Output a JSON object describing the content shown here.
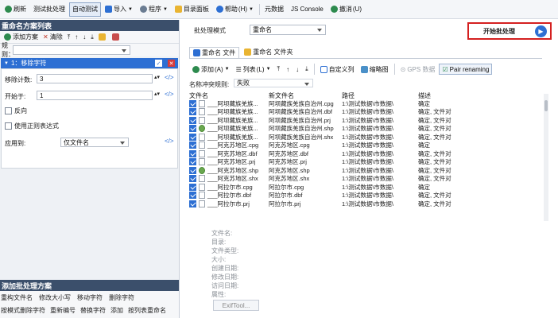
{
  "toolbar": {
    "refresh": "刷新",
    "test_batch": "测试批处理",
    "auto_test": "自动测试",
    "import": "导入",
    "program": "程序",
    "dir_panel": "目录面板",
    "help": "帮助",
    "help_key": "(H)",
    "metadata": "元数据",
    "js_console": "JS Console",
    "undo": "撤消",
    "undo_key": "(U)"
  },
  "left": {
    "rename_list_title": "重命名方案列表",
    "add_scheme": "添加方案",
    "clear": "清除",
    "rule_label": "规则：",
    "rule_item": "1：移除字符",
    "remove_count_label": "移除计数:",
    "remove_count_value": "3",
    "start_label": "开始于:",
    "start_value": "1",
    "reverse_label": "反向",
    "regex_label": "使用正则表达式",
    "apply_label": "应用到:",
    "apply_value": "仅文件名",
    "add_batch_title": "添加批处理方案",
    "actions_row1": [
      "重构文件名",
      "修改大小写",
      "移动字符",
      "删除字符"
    ],
    "actions_row2": [
      "按模式删除字符",
      "重新编号",
      "替换字符",
      "添加",
      "按列表重命名"
    ]
  },
  "right": {
    "mode_label": "批处理模式",
    "mode_value": "重命名",
    "start_button": "开始批处理",
    "tab_rename_files": "重命名 文件",
    "tab_rename_folders": "重命名 文件夹",
    "add": "添加",
    "add_key": "(A)",
    "list": "列表",
    "list_key": "(L)",
    "custom_cols": "自定义列",
    "thumbnails": "缩略图",
    "gps": "GPS 数据",
    "pair_renaming": "Pair renaming",
    "conflict_label": "名称冲突规则:",
    "conflict_value": "失败",
    "columns": [
      "文件名",
      "新文件名",
      "路径",
      "描述"
    ],
    "rows": [
      {
        "name": "___阿坝藏族羌族...",
        "new": "阿坝藏族羌族自治州.cpg",
        "path": "1:\\测试数据\\市数据\\",
        "desc": "确定",
        "icon": "file"
      },
      {
        "name": "___阿坝藏族羌族...",
        "new": "阿坝藏族羌族自治州.dbf",
        "path": "1:\\测试数据\\市数据\\",
        "desc": "确定, 文件对",
        "icon": "file"
      },
      {
        "name": "___阿坝藏族羌族...",
        "new": "阿坝藏族羌族自治州.prj",
        "path": "1:\\测试数据\\市数据\\",
        "desc": "确定, 文件对",
        "icon": "file"
      },
      {
        "name": "___阿坝藏族羌族...",
        "new": "阿坝藏族羌族自治州.shp",
        "path": "1:\\测试数据\\市数据\\",
        "desc": "确定, 文件对",
        "icon": "globe"
      },
      {
        "name": "___阿坝藏族羌族...",
        "new": "阿坝藏族羌族自治州.shx",
        "path": "1:\\测试数据\\市数据\\",
        "desc": "确定, 文件对",
        "icon": "file"
      },
      {
        "name": "___阿克苏地区.cpg",
        "new": "阿克苏地区.cpg",
        "path": "1:\\测试数据\\市数据\\",
        "desc": "确定",
        "icon": "file"
      },
      {
        "name": "___阿克苏地区.dbf",
        "new": "阿克苏地区.dbf",
        "path": "1:\\测试数据\\市数据\\",
        "desc": "确定, 文件对",
        "icon": "file"
      },
      {
        "name": "___阿克苏地区.prj",
        "new": "阿克苏地区.prj",
        "path": "1:\\测试数据\\市数据\\",
        "desc": "确定, 文件对",
        "icon": "file"
      },
      {
        "name": "___阿克苏地区.shp",
        "new": "阿克苏地区.shp",
        "path": "1:\\测试数据\\市数据\\",
        "desc": "确定, 文件对",
        "icon": "globe"
      },
      {
        "name": "___阿克苏地区.shx",
        "new": "阿克苏地区.shx",
        "path": "1:\\测试数据\\市数据\\",
        "desc": "确定, 文件对",
        "icon": "file"
      },
      {
        "name": "___阿拉尔市.cpg",
        "new": "阿拉尔市.cpg",
        "path": "1:\\测试数据\\市数据\\",
        "desc": "确定",
        "icon": "file"
      },
      {
        "name": "___阿拉尔市.dbf",
        "new": "阿拉尔市.dbf",
        "path": "1:\\测试数据\\市数据\\",
        "desc": "确定, 文件对",
        "icon": "file"
      },
      {
        "name": "___阿拉尔市.prj",
        "new": "阿拉尔市.prj",
        "path": "1:\\测试数据\\市数据\\",
        "desc": "确定, 文件对",
        "icon": "file"
      }
    ],
    "meta_labels": [
      "文件名:",
      "目录:",
      "文件类型:",
      "大小:",
      "创建日期:",
      "修改日期:",
      "访问日期:",
      "属性:"
    ],
    "exif_button": "ExifTool..."
  },
  "colors": {
    "accent": "#2d6fd3",
    "panel_head": "#3b4f6b",
    "highlight_box": "#d42020"
  }
}
